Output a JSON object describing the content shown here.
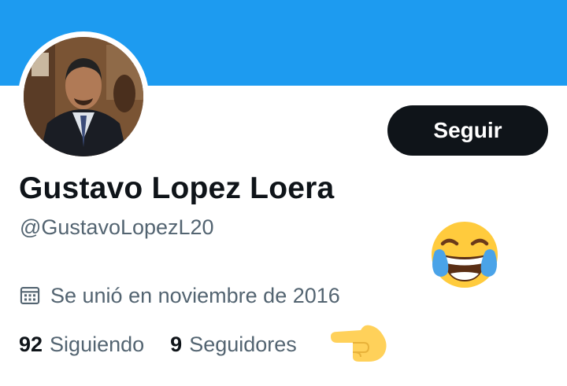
{
  "profile": {
    "display_name": "Gustavo Lopez Loera",
    "handle": "@GustavoLopezL20",
    "joined": "Se unió en noviembre de 2016",
    "follow_label": "Seguir"
  },
  "stats": {
    "following_count": "92",
    "following_label": "Siguiendo",
    "followers_count": "9",
    "followers_label": "Seguidores"
  },
  "icons": {
    "calendar": "calendar-icon",
    "laughing_emoji": "face-with-tears-of-joy",
    "pointing_emoji": "backhand-index-pointing-right"
  },
  "colors": {
    "banner": "#1d9bf0",
    "primary_text": "#0f1419",
    "secondary_text": "#536471",
    "button_bg": "#0f1419",
    "button_text": "#ffffff"
  }
}
